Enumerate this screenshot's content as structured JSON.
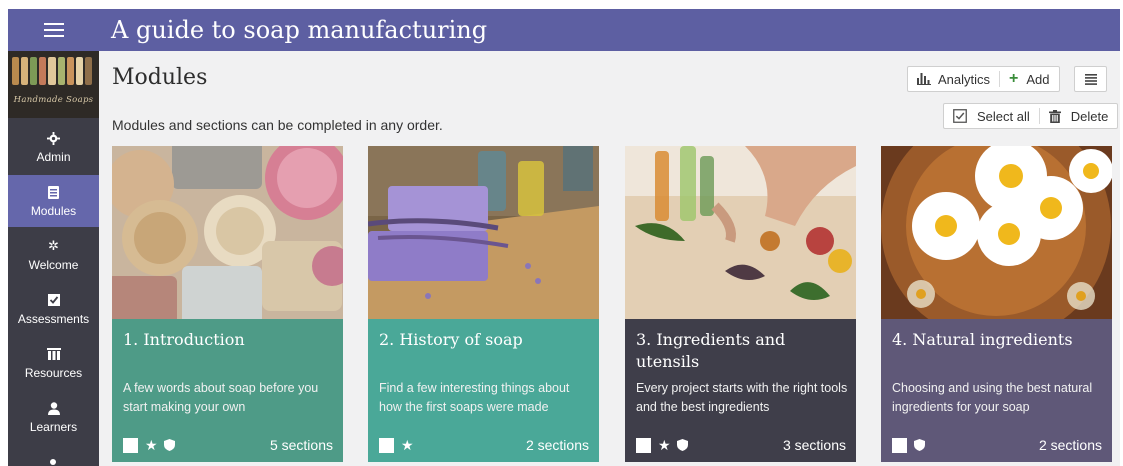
{
  "header": {
    "title": "A guide to soap manufacturing",
    "menu_icon": "hamburger-icon"
  },
  "sidebar": {
    "logo_text": "Handmade Soaps",
    "items": [
      {
        "label": "Admin",
        "icon": "gear-icon",
        "active": false
      },
      {
        "label": "Modules",
        "icon": "module-icon",
        "active": true
      },
      {
        "label": "Welcome",
        "icon": "sparkle-icon",
        "active": false
      },
      {
        "label": "Assessments",
        "icon": "checkbox-icon",
        "active": false
      },
      {
        "label": "Resources",
        "icon": "books-icon",
        "active": false
      },
      {
        "label": "Learners",
        "icon": "user-icon",
        "active": false
      }
    ]
  },
  "main": {
    "title": "Modules",
    "subtitle": "Modules and sections can be completed in any order.",
    "toolbar": {
      "analytics_label": "Analytics",
      "add_label": "Add",
      "select_all_label": "Select all",
      "delete_label": "Delete"
    }
  },
  "cards": [
    {
      "title": "1. Introduction",
      "description": "A few words about soap before you start making your own",
      "sections": "5 sections",
      "color": "#4e9b87",
      "icons": [
        "star",
        "shield"
      ]
    },
    {
      "title": "2. History of soap",
      "description": "Find a few interesting things about how the first soaps were made",
      "sections": "2 sections",
      "color": "#4aa898",
      "icons": [
        "star"
      ]
    },
    {
      "title": "3. Ingredients and utensils",
      "description": "Every project starts with the right tools and the best ingredients",
      "sections": "3 sections",
      "color": "#3f3e4a",
      "icons": [
        "star",
        "shield"
      ]
    },
    {
      "title": "4. Natural ingredients",
      "description": "Choosing and using the best natural ingredients for your soap",
      "sections": "2 sections",
      "color": "#5f5878",
      "icons": [
        "shield"
      ]
    }
  ],
  "colors": {
    "header": "#5d5fa2",
    "sidebar": "#3d3d47",
    "active_nav": "#6567ab",
    "add_icon": "#3a8d3a"
  }
}
